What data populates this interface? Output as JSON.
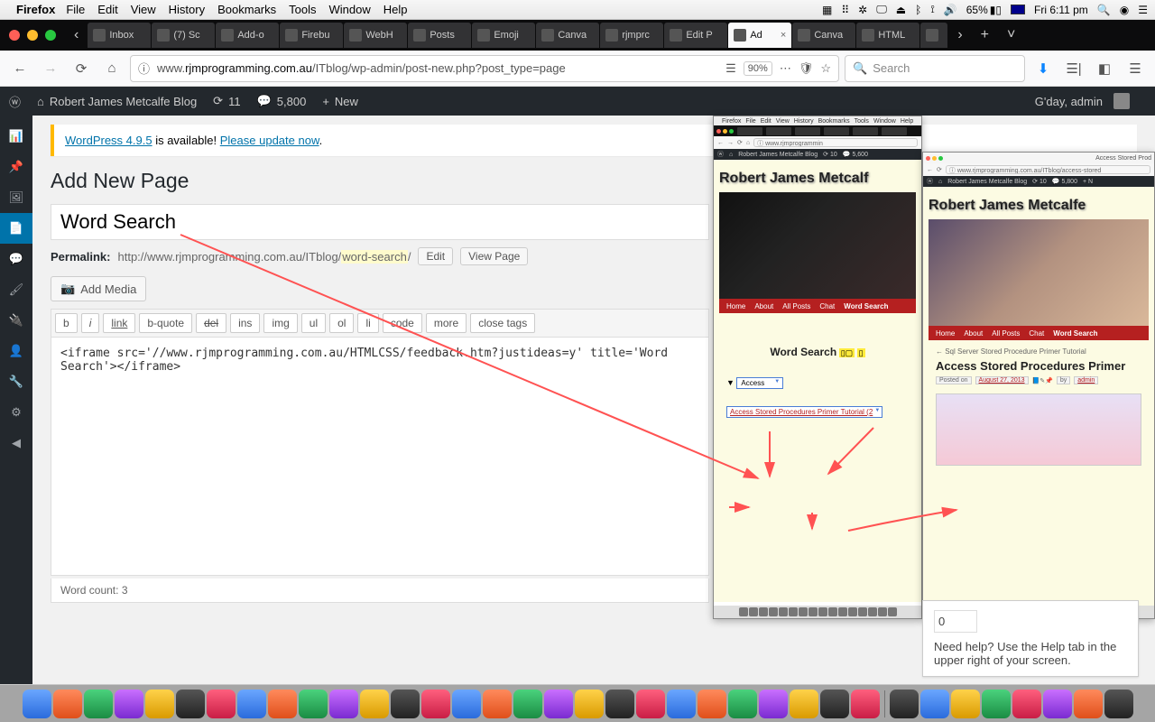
{
  "mac_menubar": {
    "app": "Firefox",
    "items": [
      "File",
      "Edit",
      "View",
      "History",
      "Bookmarks",
      "Tools",
      "Window",
      "Help"
    ],
    "battery": "65%",
    "clock": "Fri 6:11 pm"
  },
  "firefox": {
    "tabs": [
      {
        "label": "Inbox"
      },
      {
        "label": "(7) Sc"
      },
      {
        "label": "Add-o"
      },
      {
        "label": "Firebu"
      },
      {
        "label": "WebH"
      },
      {
        "label": "Posts"
      },
      {
        "label": "Emoji"
      },
      {
        "label": "Canva"
      },
      {
        "label": "rjmprc"
      },
      {
        "label": "Edit P"
      },
      {
        "label": "Ad",
        "active": true
      },
      {
        "label": "Canva"
      },
      {
        "label": "HTML"
      }
    ],
    "url_prefix": "www.",
    "url_domain": "rjmprogramming.com.au",
    "url_path": "/ITblog/wp-admin/post-new.php?post_type=page",
    "zoom": "90%",
    "search_placeholder": "Search"
  },
  "wp_adminbar": {
    "site": "Robert James Metcalfe Blog",
    "updates": "11",
    "comments": "5,800",
    "new": "New",
    "howdy": "G'day, admin"
  },
  "notice": {
    "link1": "WordPress 4.9.5",
    "mid": " is available! ",
    "link2": "Please update now"
  },
  "page": {
    "heading": "Add New Page",
    "title_value": "Word Search",
    "permalink_label": "Permalink:",
    "permalink_base": "http://www.rjmprogramming.com.au/ITblog/",
    "permalink_slug": "word-search",
    "edit_btn": "Edit",
    "view_btn": "View Page",
    "add_media": "Add Media",
    "quicktags": [
      "b",
      "i",
      "link",
      "b-quote",
      "del",
      "ins",
      "img",
      "ul",
      "ol",
      "li",
      "code",
      "more",
      "close tags"
    ],
    "editor_content": "<iframe src='//www.rjmprogramming.com.au/HTMLCSS/feedback.htm?justideas=y' title='Word Search'></iframe>",
    "wordcount_label": "Word count: ",
    "wordcount": "3"
  },
  "thumb_left": {
    "menubar_app": "Firefox",
    "menubar_items": [
      "File",
      "Edit",
      "View",
      "History",
      "Bookmarks",
      "Tools",
      "Window",
      "Help"
    ],
    "tabs": [
      "Inbox",
      "(7) S",
      "Ad",
      "Posts",
      "Emoj",
      "Canv",
      "rjmp",
      "Edit P"
    ],
    "url": "www.rjmprogrammin",
    "adminbar_site": "Robert James Metcalfe Blog",
    "adminbar_upd": "10",
    "adminbar_com": "5,600",
    "site_title": "Robert James Metcalf",
    "nav": [
      "Home",
      "About",
      "All Posts",
      "Chat",
      "Word Search"
    ],
    "ws_title": "Word Search",
    "select_value": "Access",
    "result": "Access Stored Procedures Primer Tutorial (2"
  },
  "thumb_right": {
    "url": "www.rjmprogramming.com.au/ITblog/access-stored",
    "page_label": "Access Stored Prod",
    "adminbar_site": "Robert James Metcalfe Blog",
    "adminbar_upd": "10",
    "adminbar_com": "5,800",
    "adminbar_new": "+ N",
    "site_title": "Robert James Metcalfe",
    "nav": [
      "Home",
      "About",
      "All Posts",
      "Chat",
      "Word Search"
    ],
    "older": "← Sql Server Stored Procedure Primer Tutorial",
    "post_title": "Access Stored Procedures Primer",
    "posted_on": "Posted on",
    "date": "August 27, 2013",
    "by": "by",
    "author": "admin"
  },
  "helpbox": {
    "zero": "0",
    "text": "Need help? Use the Help tab in the upper right of your screen."
  }
}
